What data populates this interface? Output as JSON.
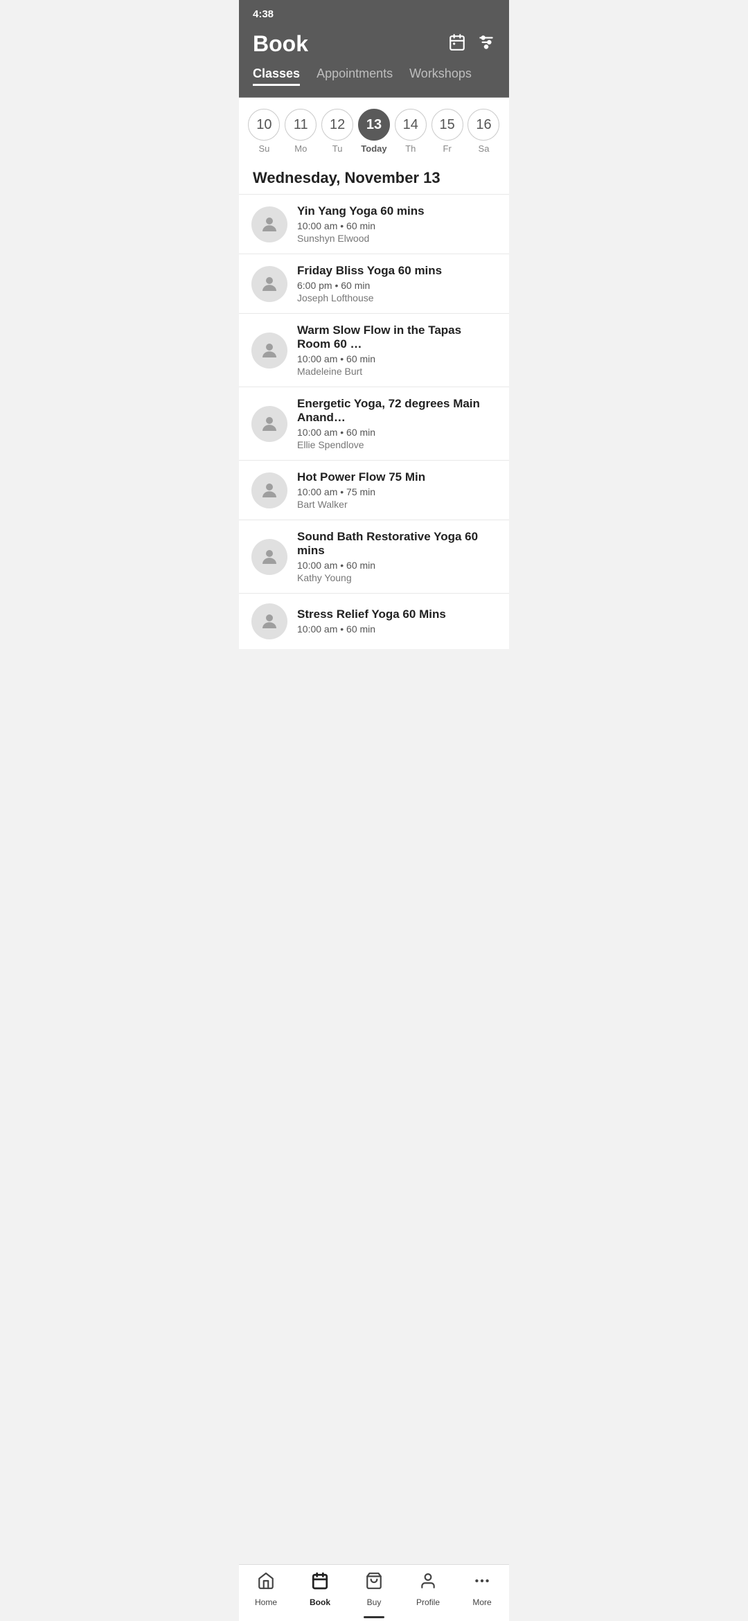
{
  "statusBar": {
    "time": "4:38"
  },
  "header": {
    "title": "Book",
    "calendarIconLabel": "calendar-icon",
    "filterIconLabel": "filter-icon"
  },
  "tabs": [
    {
      "id": "classes",
      "label": "Classes",
      "active": true
    },
    {
      "id": "appointments",
      "label": "Appointments",
      "active": false
    },
    {
      "id": "workshops",
      "label": "Workshops",
      "active": false
    }
  ],
  "datePicker": {
    "days": [
      {
        "number": "10",
        "label": "Su",
        "state": "normal"
      },
      {
        "number": "11",
        "label": "Mo",
        "state": "normal"
      },
      {
        "number": "12",
        "label": "Tu",
        "state": "normal"
      },
      {
        "number": "13",
        "label": "Today",
        "state": "today"
      },
      {
        "number": "14",
        "label": "Th",
        "state": "normal"
      },
      {
        "number": "15",
        "label": "Fr",
        "state": "normal"
      },
      {
        "number": "16",
        "label": "Sa",
        "state": "normal"
      }
    ]
  },
  "dayHeading": "Wednesday, November 13",
  "classes": [
    {
      "id": 1,
      "name": "Yin Yang Yoga 60 mins",
      "time": "10:00 am • 60 min",
      "instructor": "Sunshyn Elwood"
    },
    {
      "id": 2,
      "name": "Friday Bliss Yoga 60 mins",
      "time": "6:00 pm • 60 min",
      "instructor": "Joseph Lofthouse"
    },
    {
      "id": 3,
      "name": "Warm Slow Flow in the Tapas Room 60 …",
      "time": "10:00 am • 60 min",
      "instructor": "Madeleine Burt"
    },
    {
      "id": 4,
      "name": "Energetic Yoga, 72 degrees Main Anand…",
      "time": "10:00 am • 60 min",
      "instructor": "Ellie Spendlove"
    },
    {
      "id": 5,
      "name": "Hot Power Flow 75 Min",
      "time": "10:00 am • 75 min",
      "instructor": "Bart Walker"
    },
    {
      "id": 6,
      "name": "Sound Bath Restorative Yoga 60 mins",
      "time": "10:00 am • 60 min",
      "instructor": "Kathy Young"
    },
    {
      "id": 7,
      "name": "Stress Relief Yoga 60 Mins",
      "time": "10:00 am • 60 min",
      "instructor": ""
    }
  ],
  "bottomNav": [
    {
      "id": "home",
      "label": "Home",
      "active": false,
      "icon": "home"
    },
    {
      "id": "book",
      "label": "Book",
      "active": true,
      "icon": "book"
    },
    {
      "id": "buy",
      "label": "Buy",
      "active": false,
      "icon": "buy"
    },
    {
      "id": "profile",
      "label": "Profile",
      "active": false,
      "icon": "profile"
    },
    {
      "id": "more",
      "label": "More",
      "active": false,
      "icon": "more"
    }
  ]
}
